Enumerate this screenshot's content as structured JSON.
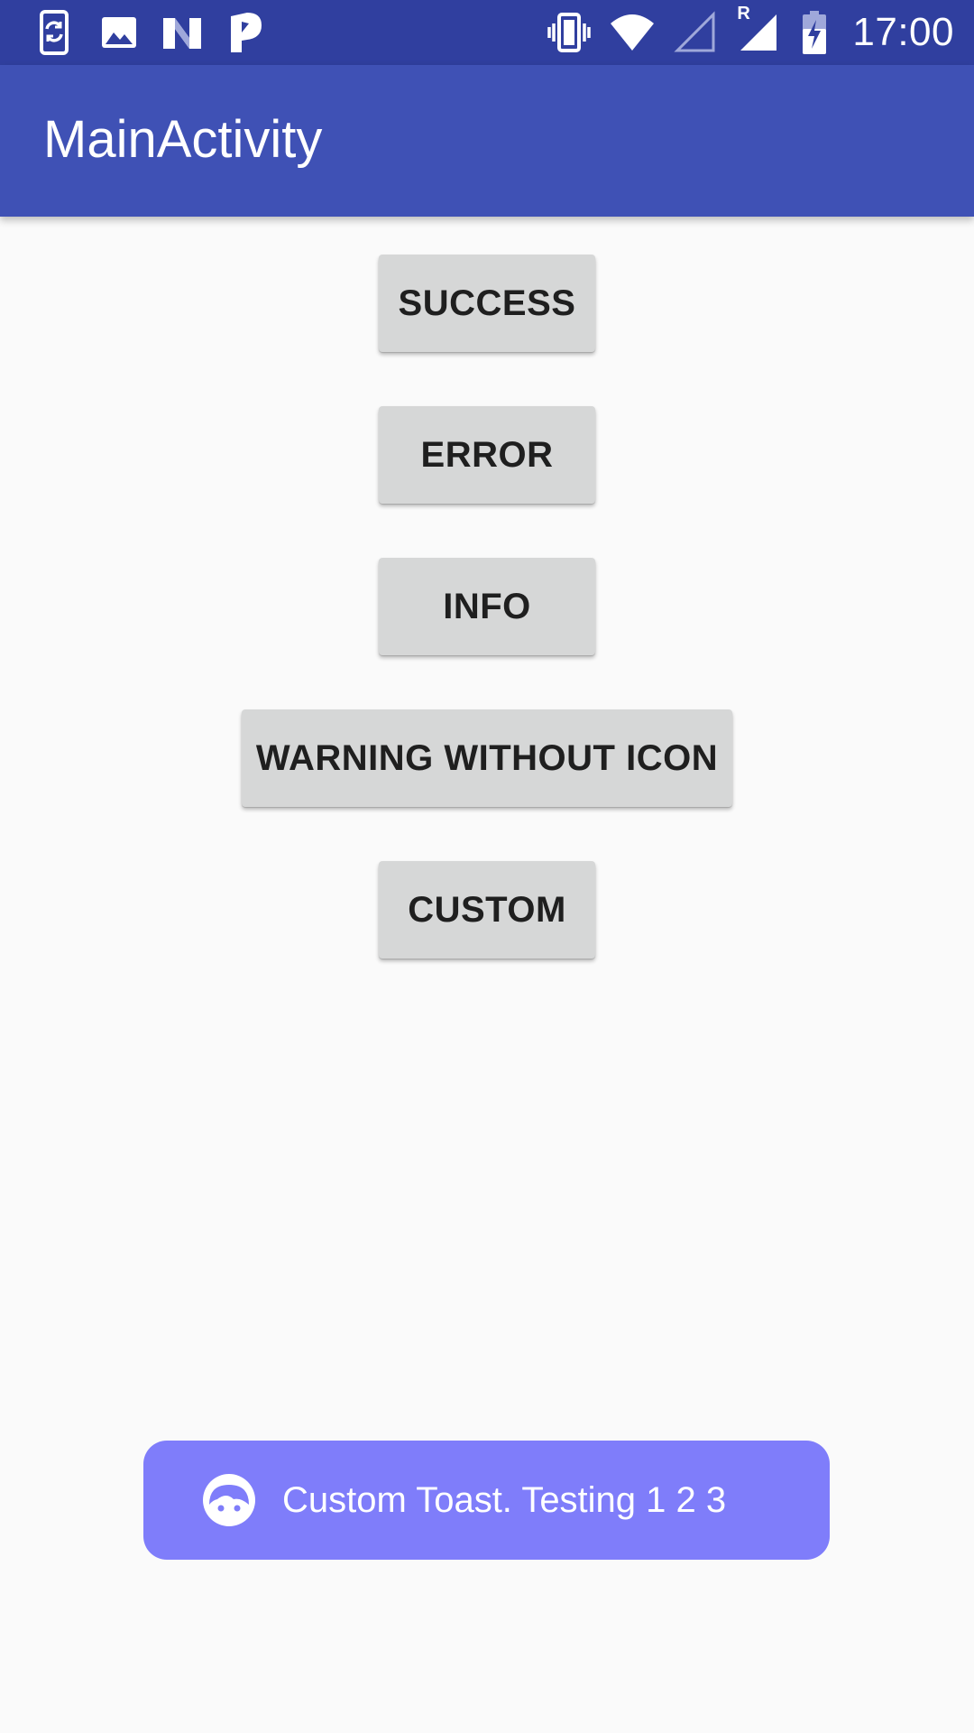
{
  "status_bar": {
    "time": "17:00",
    "left_icons": [
      "phone-sync-icon",
      "image-icon",
      "n-logo-icon",
      "p-logo-icon"
    ],
    "right_icons": [
      "vibrate-icon",
      "wifi-icon",
      "signal-empty-icon",
      "signal-roaming-icon",
      "battery-charging-icon"
    ],
    "roaming_label": "R",
    "background_color": "#303f9f"
  },
  "app_bar": {
    "title": "MainActivity",
    "background_color": "#3f51b5"
  },
  "buttons": {
    "success": "SUCCESS",
    "error": "ERROR",
    "info": "INFO",
    "warning": "WARNING WITHOUT ICON",
    "custom": "CUSTOM"
  },
  "toast": {
    "icon": "face-icon",
    "text": "Custom Toast. Testing 1 2 3",
    "background_color": "#7f7dfa"
  }
}
